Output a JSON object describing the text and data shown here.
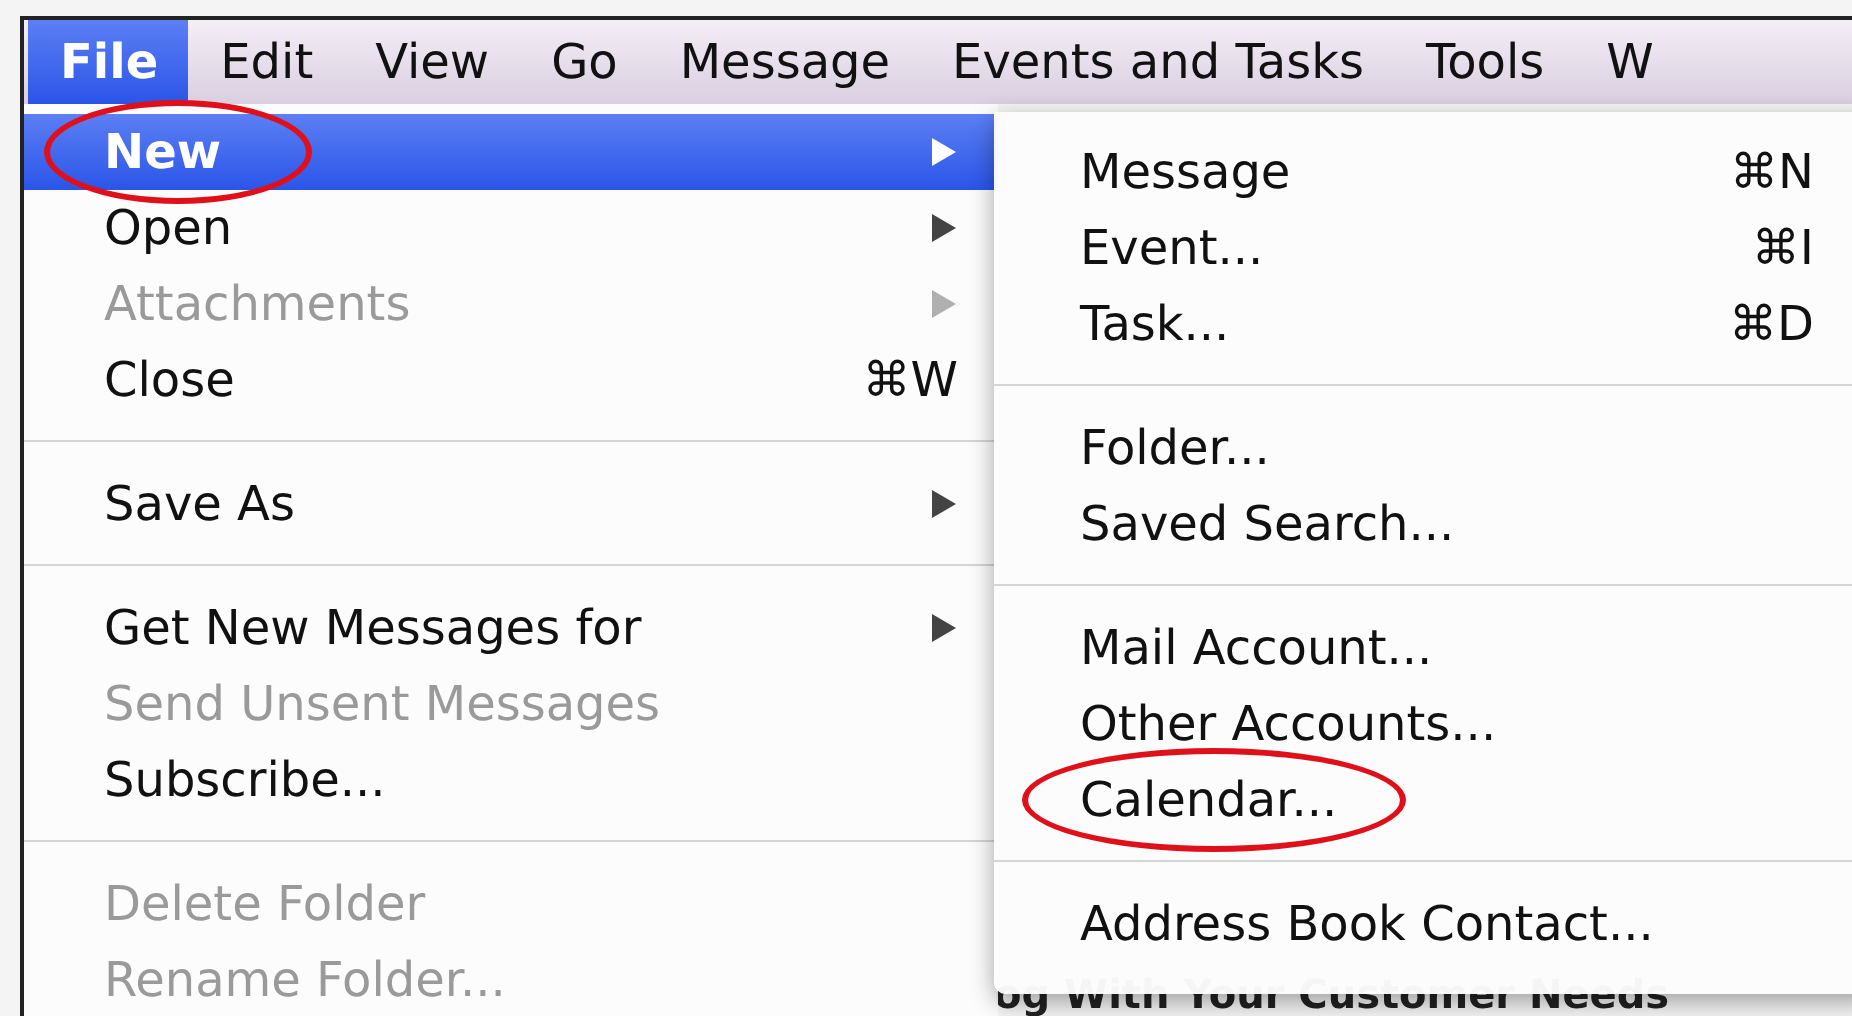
{
  "menubar": [
    {
      "label": "File",
      "selected": true
    },
    {
      "label": "Edit",
      "selected": false
    },
    {
      "label": "View",
      "selected": false
    },
    {
      "label": "Go",
      "selected": false
    },
    {
      "label": "Message",
      "selected": false
    },
    {
      "label": "Events and Tasks",
      "selected": false
    },
    {
      "label": "Tools",
      "selected": false
    },
    {
      "label": "W",
      "selected": false
    }
  ],
  "file_menu": [
    {
      "kind": "item",
      "label": "New",
      "has_submenu": true,
      "disabled": false,
      "selected": true,
      "circled": true
    },
    {
      "kind": "item",
      "label": "Open",
      "has_submenu": true,
      "disabled": false,
      "selected": false,
      "circled": false
    },
    {
      "kind": "item",
      "label": "Attachments",
      "has_submenu": true,
      "disabled": true,
      "selected": false,
      "circled": false
    },
    {
      "kind": "item",
      "label": "Close",
      "shortcut": "⌘W",
      "has_submenu": false,
      "disabled": false,
      "selected": false,
      "circled": false
    },
    {
      "kind": "separator"
    },
    {
      "kind": "item",
      "label": "Save As",
      "has_submenu": true,
      "disabled": false,
      "selected": false,
      "circled": false
    },
    {
      "kind": "separator"
    },
    {
      "kind": "item",
      "label": "Get New Messages for",
      "has_submenu": true,
      "disabled": false,
      "selected": false,
      "circled": false
    },
    {
      "kind": "item",
      "label": "Send Unsent Messages",
      "has_submenu": false,
      "disabled": true,
      "selected": false,
      "circled": false
    },
    {
      "kind": "item",
      "label": "Subscribe...",
      "has_submenu": false,
      "disabled": false,
      "selected": false,
      "circled": false
    },
    {
      "kind": "separator"
    },
    {
      "kind": "item",
      "label": "Delete Folder",
      "has_submenu": false,
      "disabled": true,
      "selected": false,
      "circled": false
    },
    {
      "kind": "item",
      "label": "Rename Folder...",
      "has_submenu": false,
      "disabled": true,
      "selected": false,
      "circled": false
    }
  ],
  "new_submenu": [
    {
      "kind": "item",
      "label": "Message",
      "shortcut": "⌘N",
      "selected": false,
      "circled": false
    },
    {
      "kind": "item",
      "label": "Event...",
      "shortcut": "⌘I",
      "selected": false,
      "circled": false
    },
    {
      "kind": "item",
      "label": "Task...",
      "shortcut": "⌘D",
      "selected": false,
      "circled": false
    },
    {
      "kind": "separator"
    },
    {
      "kind": "item",
      "label": "Folder...",
      "selected": false,
      "circled": false
    },
    {
      "kind": "item",
      "label": "Saved Search...",
      "selected": false,
      "circled": false
    },
    {
      "kind": "separator"
    },
    {
      "kind": "item",
      "label": "Mail Account...",
      "selected": false,
      "circled": false
    },
    {
      "kind": "item",
      "label": "Other Accounts...",
      "selected": false,
      "circled": false
    },
    {
      "kind": "item",
      "label": "Calendar...",
      "selected": false,
      "circled": true
    },
    {
      "kind": "separator"
    },
    {
      "kind": "item",
      "label": "Address Book Contact...",
      "selected": false,
      "circled": false
    }
  ],
  "background_text": "og With Your Customer Needs"
}
